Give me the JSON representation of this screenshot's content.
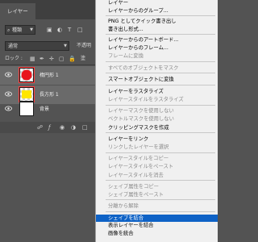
{
  "layers_panel": {
    "tab_label": "レイヤー",
    "filter": {
      "kind": "種類",
      "icon_names": [
        "image-filter-icon",
        "adjustment-filter-icon",
        "type-filter-icon",
        "shape-filter-icon"
      ]
    },
    "blend_mode": "通常",
    "opacity_label": "不透明",
    "lock_label": "ロック :",
    "fill_label": "塗",
    "layers": [
      {
        "name": "楕円形 1",
        "thumb": "red-circle",
        "selected": true
      },
      {
        "name": "長方形 1",
        "thumb": "yellow-rect",
        "selected": true
      },
      {
        "name": "背景",
        "thumb": "white",
        "selected": false
      }
    ],
    "footer_icons": [
      "link-icon",
      "fx-icon",
      "mask-icon",
      "adjustment-icon",
      "folder-icon"
    ]
  },
  "context_menu": {
    "items": [
      {
        "label": "レイヤー",
        "disabled": false
      },
      {
        "label": "レイヤーからのグループ...",
        "disabled": false
      },
      {
        "label": "PNG としてクイック書き出し",
        "disabled": false
      },
      {
        "label": "書き出し形式...",
        "disabled": false
      },
      {
        "label": "レイヤーからのアートボード...",
        "disabled": false
      },
      {
        "label": "レイヤーからのフレーム...",
        "disabled": false
      },
      {
        "label": "フレームに変換",
        "disabled": true
      },
      {
        "label": "すべてのオブジェクトをマスク",
        "disabled": true
      },
      {
        "label": "スマートオブジェクトに変換",
        "disabled": false
      },
      {
        "label": "レイヤーをラスタライズ",
        "disabled": false
      },
      {
        "label": "レイヤースタイルをラスタライズ",
        "disabled": true
      },
      {
        "label": "レイヤーマスクを使用しない",
        "disabled": true
      },
      {
        "label": "ベクトルマスクを使用しない",
        "disabled": true
      },
      {
        "label": "クリッピングマスクを作成",
        "disabled": false
      },
      {
        "label": "レイヤーをリンク",
        "disabled": false
      },
      {
        "label": "リンクしたレイヤーを選択",
        "disabled": true
      },
      {
        "label": "レイヤースタイルをコピー",
        "disabled": true
      },
      {
        "label": "レイヤースタイルをペースト",
        "disabled": true
      },
      {
        "label": "レイヤースタイルを消去",
        "disabled": true
      },
      {
        "label": "シェイプ属性をコピー",
        "disabled": true
      },
      {
        "label": "シェイプ属性をペースト",
        "disabled": true
      },
      {
        "label": "分離から解除",
        "disabled": true
      },
      {
        "label": "シェイプを結合",
        "disabled": false,
        "highlighted": true
      },
      {
        "label": "表示レイヤーを結合",
        "disabled": false
      },
      {
        "label": "画像を統合",
        "disabled": false
      }
    ]
  },
  "colors": {
    "panel_bg": "#535353",
    "selected_row": "#6a6a6a",
    "menu_bg": "#f0f0f0",
    "menu_highlight": "#0e62c6",
    "thumb_red": "#e8141c",
    "thumb_yellow": "#ffe600",
    "selection_outline": "#ff3b3b"
  }
}
